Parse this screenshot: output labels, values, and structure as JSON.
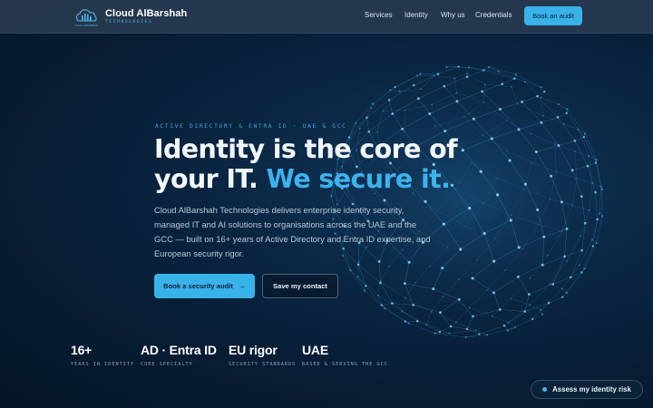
{
  "brand": {
    "name": "Cloud AlBarshah",
    "subtitle": "TECHNOLOGIES",
    "mark_text": "CLOUD ALBARSHAH"
  },
  "nav": {
    "links": [
      "Services",
      "Identity",
      "Why us",
      "Credentials"
    ],
    "cta": "Book an audit"
  },
  "hero": {
    "eyebrow": "ACTIVE DIRECTORY & ENTRA ID · UAE & GCC",
    "headline_main": "Identity is the core of your IT.",
    "headline_accent": "We secure it.",
    "description": "Cloud AlBarshah Technologies delivers enterprise identity security, managed IT and AI solutions to organisations across the UAE and the GCC — built on 16+ years of Active Directory and Entra ID expertise, and European security rigor.",
    "primary_button": "Book a security audit",
    "primary_arrow": "→",
    "secondary_button": "Save my contact"
  },
  "stats": [
    {
      "value": "16+",
      "label": "YEARS IN IDENTITY"
    },
    {
      "value": "AD · Entra ID",
      "label": "CORE SPECIALTY"
    },
    {
      "value": "EU rigor",
      "label": "SECURITY STANDARDS"
    },
    {
      "value": "UAE",
      "label": "BASED & SERVING THE GCC"
    }
  ],
  "floating_cta": "Assess my identity risk",
  "colors": {
    "accent": "#39b2ea",
    "background": "#071a30",
    "nav": "#283a50"
  }
}
